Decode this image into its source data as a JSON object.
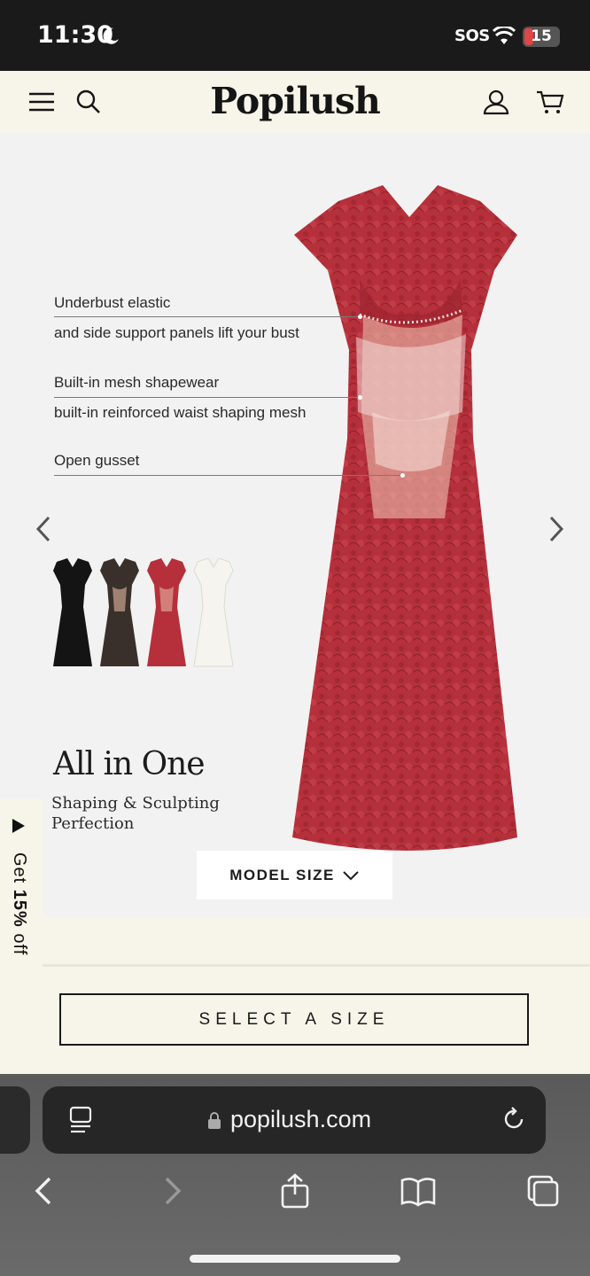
{
  "status_bar": {
    "time": "11:30",
    "sos": "SOS",
    "battery": "15"
  },
  "header": {
    "logo": "Popilush"
  },
  "hero": {
    "features": [
      {
        "title": "Underbust elastic",
        "detail": "and side support panels lift your bust"
      },
      {
        "title": "Built-in mesh shapewear",
        "detail": "built-in reinforced waist shaping mesh"
      },
      {
        "title": "Open gusset"
      }
    ],
    "color_swatches": [
      "black",
      "black-nude",
      "red",
      "white"
    ],
    "title": "All in One",
    "subtitle": "Shaping & Sculpting Perfection",
    "model_size_label": "MODEL SIZE"
  },
  "promo": {
    "prefix": "Get ",
    "percent": "15%",
    "suffix": " off"
  },
  "select_size_label": "SELECT A SIZE",
  "browser": {
    "url": "popilush.com"
  },
  "colors": {
    "header_bg": "#f7f5e9",
    "dress_red": "#b5303a",
    "status_bg": "#1a1a1a"
  }
}
